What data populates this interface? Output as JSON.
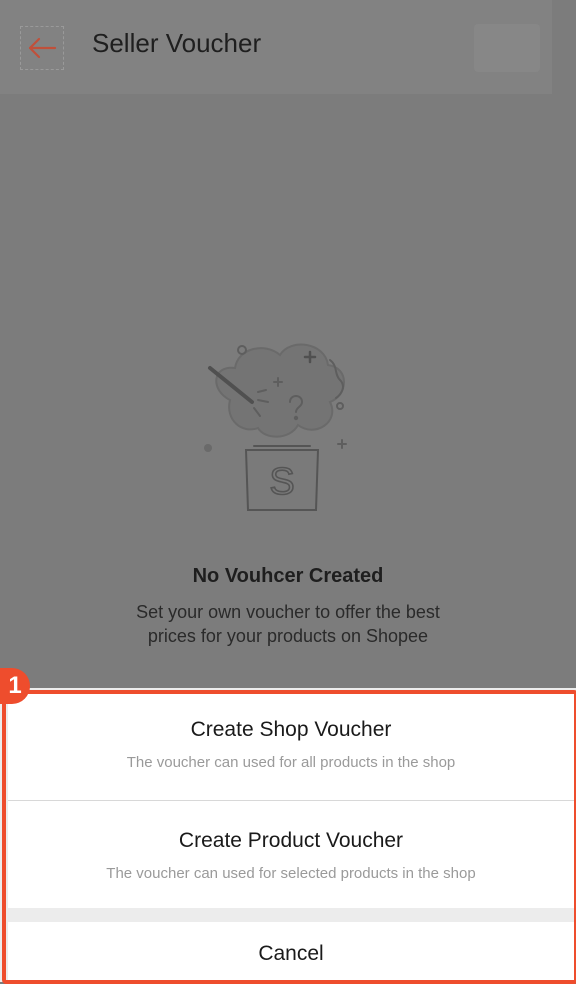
{
  "header": {
    "title": "Seller Voucher",
    "back_icon": "back-arrow-icon"
  },
  "empty_state": {
    "title": "No Vouhcer Created",
    "description_line1": "Set your own voucher to offer the best",
    "description_line2": "prices for your products on Shopee",
    "illustration_icon": "magic-box-icon",
    "box_letter": "S"
  },
  "sheet": {
    "options": [
      {
        "title": "Create Shop Voucher",
        "subtitle": "The voucher can used for all products in the shop"
      },
      {
        "title": "Create Product Voucher",
        "subtitle": "The voucher can used for selected products in the shop"
      }
    ],
    "cancel_label": "Cancel"
  },
  "annotation": {
    "badge_label": "1",
    "color": "#ee4d2d"
  },
  "colors": {
    "accent": "#ee4d2d",
    "overlay": "#7c7c7c",
    "sheet_bg": "#ffffff"
  }
}
